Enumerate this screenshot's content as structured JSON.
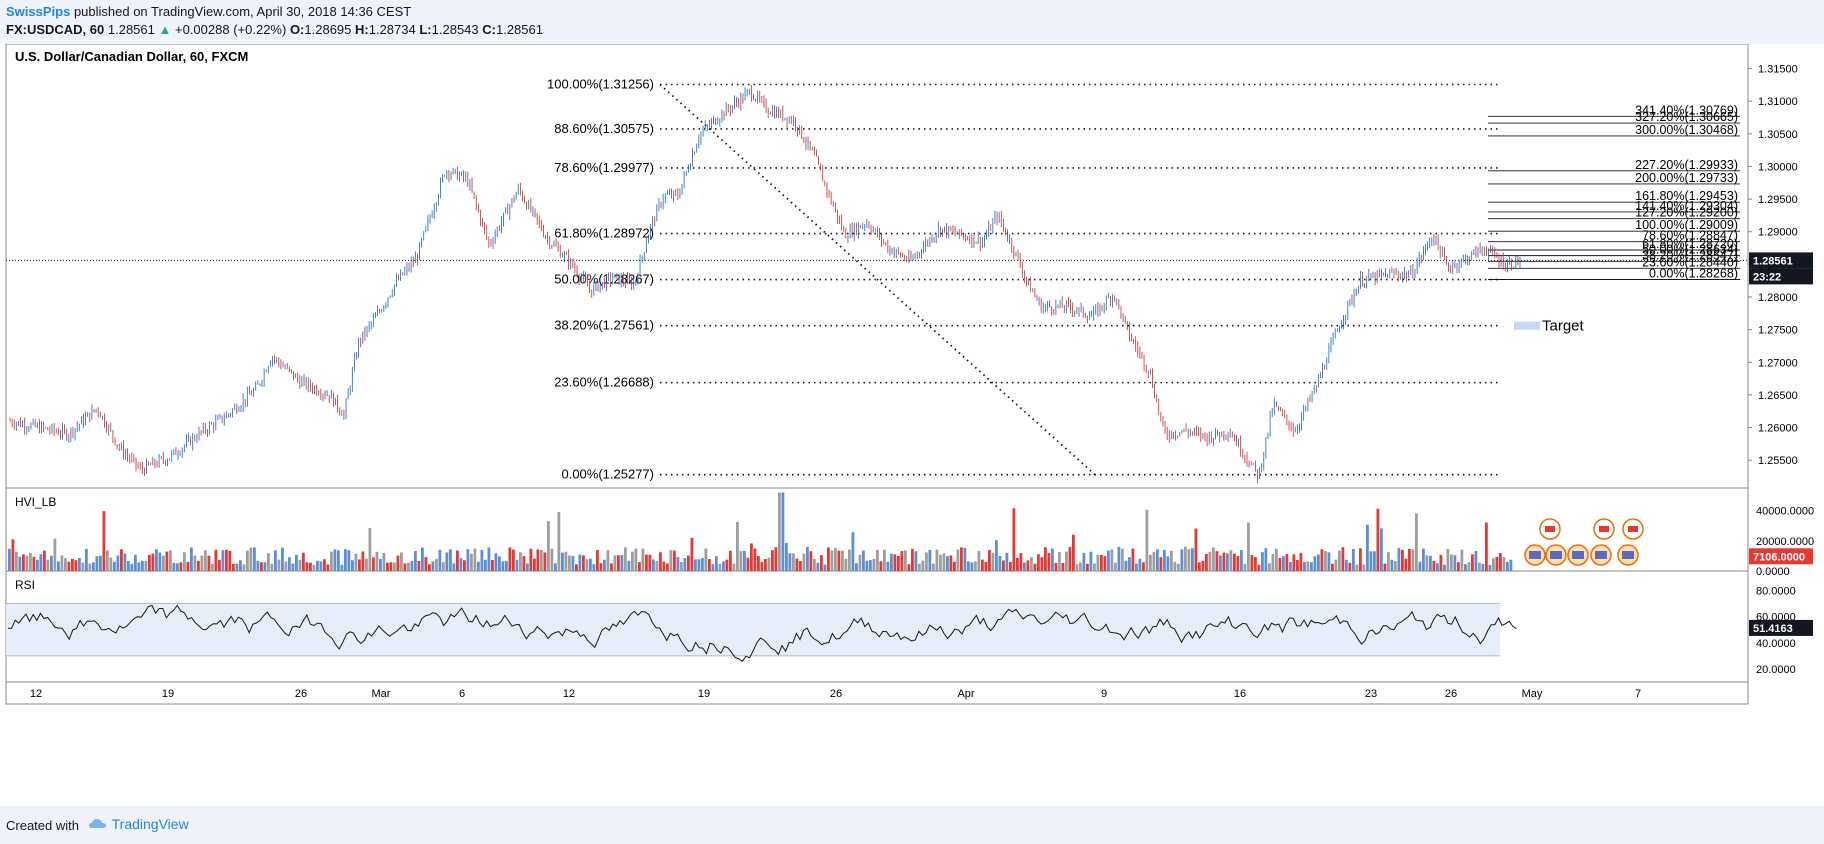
{
  "header": {
    "author": "SwissPips",
    "published": "published on TradingView.com, April 30, 2018 14:36 CEST",
    "symbol": "FX:USDCAD, 60",
    "last": "1.28561",
    "change": "+0.00288 (+0.22%)",
    "open_label": "O:",
    "open": "1.28695",
    "high_label": "H:",
    "high": "1.28734",
    "low_label": "L:",
    "low": "1.28543",
    "close_label": "C:",
    "close": "1.28561"
  },
  "footer": {
    "created_with": "Created with",
    "brand": "TradingView"
  },
  "colors": {
    "up": "#26a69a",
    "down": "#ef5350",
    "candle_up": "#1565c0",
    "candle_down": "#c62828",
    "vol_red": "#e53935",
    "vol_blue": "#5b8fd9",
    "vol_grey": "#9e9e9e",
    "rsi_band": "#e8eef9"
  },
  "chart_data": [
    {
      "type": "candlestick",
      "title": "U.S. Dollar/Canadian Dollar, 60, FXCM",
      "ylim": [
        1.2515,
        1.318
      ],
      "y_ticks": [
        "1.31500",
        "1.31000",
        "1.30500",
        "1.30000",
        "1.29500",
        "1.29000",
        "1.28500",
        "1.28000",
        "1.27500",
        "1.27000",
        "1.26500",
        "1.26000",
        "1.25500"
      ],
      "y_tick_values": [
        1.315,
        1.31,
        1.305,
        1.3,
        1.295,
        1.29,
        1.285,
        1.28,
        1.275,
        1.27,
        1.265,
        1.26,
        1.255
      ],
      "x_labels": [
        "12",
        "19",
        "26",
        "Mar",
        "6",
        "12",
        "19",
        "26",
        "Apr",
        "9",
        "16",
        "23",
        "26",
        "May",
        "7"
      ],
      "last_price": "1.28561",
      "last_price_value": 1.28561,
      "countdown": "23:22",
      "price_path": [
        [
          0,
          1.261
        ],
        [
          8,
          1.259
        ],
        [
          12,
          1.263
        ],
        [
          15,
          1.257
        ],
        [
          18,
          1.2535
        ],
        [
          22,
          1.2555
        ],
        [
          26,
          1.259
        ],
        [
          30,
          1.262
        ],
        [
          34,
          1.266
        ],
        [
          36,
          1.271
        ],
        [
          40,
          1.267
        ],
        [
          44,
          1.265
        ],
        [
          46,
          1.262
        ],
        [
          48,
          1.273
        ],
        [
          51,
          1.278
        ],
        [
          53,
          1.282
        ],
        [
          56,
          1.286
        ],
        [
          60,
          1.2995
        ],
        [
          63,
          1.298
        ],
        [
          66,
          1.288
        ],
        [
          70,
          1.2965
        ],
        [
          74,
          1.289
        ],
        [
          77,
          1.2855
        ],
        [
          80,
          1.281
        ],
        [
          83,
          1.283
        ],
        [
          86,
          1.282
        ],
        [
          88,
          1.29
        ],
        [
          90,
          1.2955
        ],
        [
          92,
          1.2955
        ],
        [
          95,
          1.305
        ],
        [
          98,
          1.308
        ],
        [
          102,
          1.3115
        ],
        [
          104,
          1.309
        ],
        [
          108,
          1.307
        ],
        [
          111,
          1.301
        ],
        [
          113,
          1.295
        ],
        [
          115,
          1.2895
        ],
        [
          118,
          1.2915
        ],
        [
          121,
          1.2875
        ],
        [
          124,
          1.2855
        ],
        [
          128,
          1.2905
        ],
        [
          131,
          1.2895
        ],
        [
          134,
          1.2885
        ],
        [
          136,
          1.2925
        ],
        [
          138,
          1.288
        ],
        [
          140,
          1.2825
        ],
        [
          142,
          1.2785
        ],
        [
          146,
          1.2785
        ],
        [
          149,
          1.277
        ],
        [
          152,
          1.2805
        ],
        [
          154,
          1.2745
        ],
        [
          157,
          1.2685
        ],
        [
          159,
          1.259
        ],
        [
          162,
          1.2595
        ],
        [
          165,
          1.2585
        ],
        [
          168,
          1.2595
        ],
        [
          172,
          1.2525
        ],
        [
          174,
          1.2635
        ],
        [
          177,
          1.2595
        ],
        [
          180,
          1.2665
        ],
        [
          183,
          1.2755
        ],
        [
          186,
          1.2825
        ],
        [
          190,
          1.2835
        ],
        [
          193,
          1.2835
        ],
        [
          196,
          1.2895
        ],
        [
          198,
          1.2845
        ],
        [
          200,
          1.2855
        ],
        [
          203,
          1.2875
        ],
        [
          206,
          1.285
        ],
        [
          208,
          1.2856
        ]
      ],
      "fib_retracement": [
        {
          "label": "100.00%(1.31256)",
          "value": 1.31256
        },
        {
          "label": "88.60%(1.30575)",
          "value": 1.30575
        },
        {
          "label": "78.60%(1.29977)",
          "value": 1.29977
        },
        {
          "label": "61.80%(1.28972)",
          "value": 1.28972
        },
        {
          "label": "50.00%(1.28267)",
          "value": 1.28267
        },
        {
          "label": "38.20%(1.27561)",
          "value": 1.27561
        },
        {
          "label": "23.60%(1.26688)",
          "value": 1.26688
        },
        {
          "label": "0.00%(1.25277)",
          "value": 1.25277
        }
      ],
      "fib_extension": [
        {
          "label": "341.40%(1.30769)",
          "value": 1.30769
        },
        {
          "label": "327.20%(1.30665)",
          "value": 1.30665
        },
        {
          "label": "300.00%(1.30468)",
          "value": 1.30468
        },
        {
          "label": "227.20%(1.29933)",
          "value": 1.29933
        },
        {
          "label": "200.00%(1.29733)",
          "value": 1.29733
        },
        {
          "label": "161.80%(1.29453)",
          "value": 1.29453
        },
        {
          "label": "141.40%(1.29304)",
          "value": 1.29304
        },
        {
          "label": "127.20%(1.29200)",
          "value": 1.292
        },
        {
          "label": "100.00%(1.29009)",
          "value": 1.29009
        },
        {
          "label": "78.60%(1.28847)",
          "value": 1.28847
        },
        {
          "label": "61.80%(1.28720)",
          "value": 1.2872
        },
        {
          "label": "50.00%(1.28634)",
          "value": 1.28634
        },
        {
          "label": "38.20%(1.28547)",
          "value": 1.28547
        },
        {
          "label": "23.60%(1.28440)",
          "value": 1.2844
        },
        {
          "label": "0.00%(1.28268)",
          "value": 1.28268
        }
      ],
      "target_label": "Target",
      "target_value": 1.2756
    },
    {
      "type": "bar",
      "title": "HVI_LB",
      "ylim": [
        0,
        55000
      ],
      "y_ticks": [
        "40000.0000",
        "20000.0000",
        "0.0000"
      ],
      "y_tick_values": [
        40000,
        20000,
        0
      ],
      "last_value": "7106.0000",
      "last_value_num": 7106
    },
    {
      "type": "line",
      "title": "RSI",
      "ylim": [
        10,
        95
      ],
      "y_ticks": [
        "80.0000",
        "60.0000",
        "40.0000",
        "20.0000"
      ],
      "y_tick_values": [
        80,
        60,
        40,
        20
      ],
      "band": [
        30,
        70
      ],
      "last_value": "51.4163",
      "last_value_num": 51.4163
    }
  ]
}
